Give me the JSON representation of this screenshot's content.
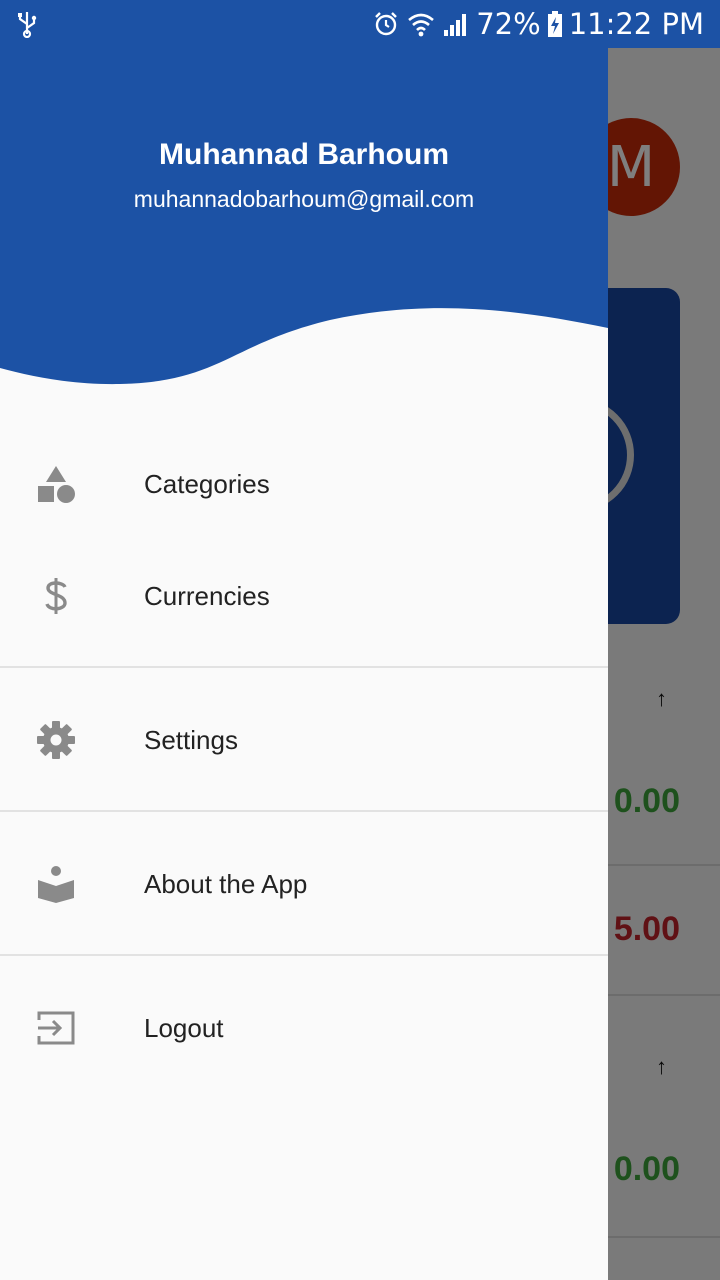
{
  "status_bar": {
    "battery": "72%",
    "time": "11:22 PM",
    "icons": [
      "usb-icon",
      "alarm-icon",
      "wifi-icon",
      "signal-icon",
      "battery-charging-icon"
    ]
  },
  "background": {
    "avatar_letter": "M",
    "amounts": [
      {
        "text": "0.00",
        "color": "green"
      },
      {
        "text": "5.00",
        "color": "red"
      },
      {
        "text": "0.00",
        "color": "green"
      }
    ],
    "arrow_glyph": "↑"
  },
  "drawer": {
    "user_name": "Muhannad Barhoum",
    "user_email": "muhannadobarhoum@gmail.com",
    "items": [
      {
        "label": "Categories",
        "icon": "shapes-icon"
      },
      {
        "label": "Currencies",
        "icon": "dollar-icon"
      },
      {
        "label": "Settings",
        "icon": "gear-icon"
      },
      {
        "label": "About the App",
        "icon": "reader-icon"
      },
      {
        "label": "Logout",
        "icon": "logout-icon"
      }
    ]
  },
  "colors": {
    "header_blue": "#1c52a5",
    "icon_gray": "#8a8a8a",
    "avatar_red": "#c62a09"
  }
}
